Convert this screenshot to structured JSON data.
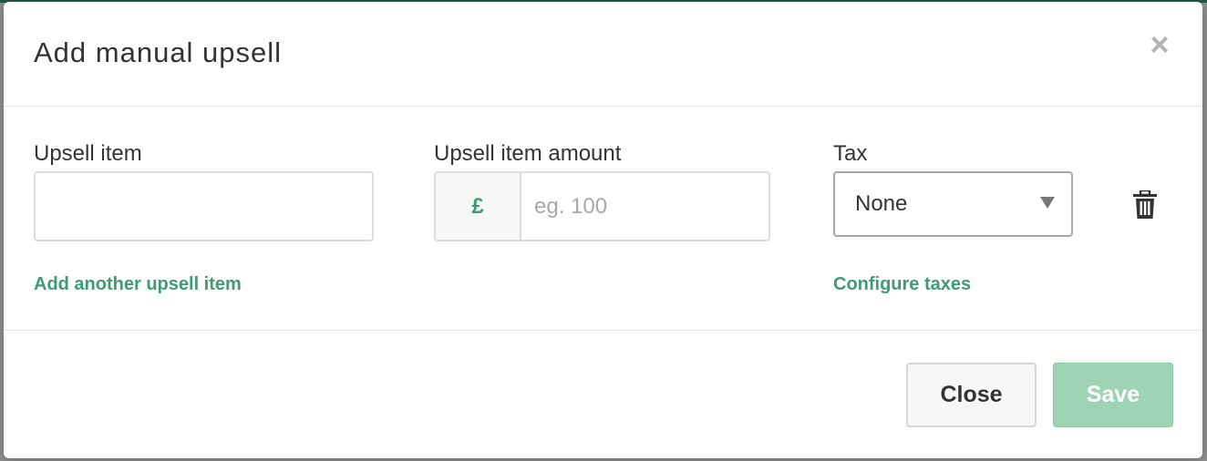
{
  "dialog": {
    "title": "Add manual upsell",
    "close_symbol": "×"
  },
  "form": {
    "upsell_item": {
      "label": "Upsell item",
      "value": "",
      "placeholder": ""
    },
    "upsell_amount": {
      "label": "Upsell item amount",
      "currency_symbol": "£",
      "value": "",
      "placeholder": "eg. 100"
    },
    "tax": {
      "label": "Tax",
      "selected": "None"
    },
    "add_another_link": "Add another upsell item",
    "configure_taxes_link": "Configure taxes"
  },
  "footer": {
    "close_label": "Close",
    "save_label": "Save"
  },
  "icons": {
    "delete": "trash-icon",
    "dismiss": "close-icon",
    "dropdown": "caret-down-icon"
  },
  "colors": {
    "accent_green": "#3f9b73",
    "save_disabled_green": "#9fd3b6"
  }
}
